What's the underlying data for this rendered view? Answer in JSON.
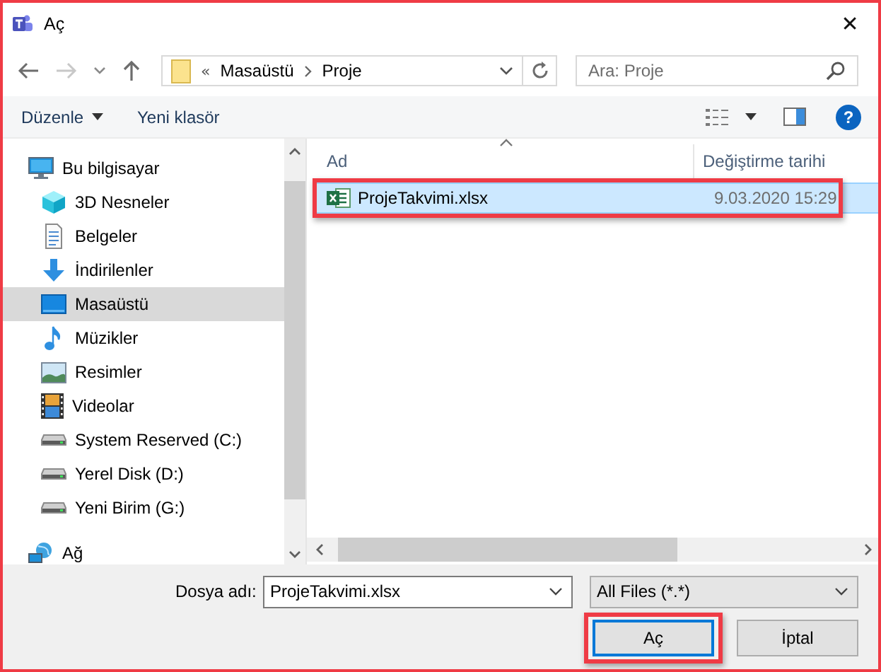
{
  "window": {
    "title": "Aç",
    "close": "✕"
  },
  "nav": {
    "back": {
      "disabled": false
    },
    "forward": {
      "disabled": true
    }
  },
  "address": {
    "overflow_mark": "«",
    "path": [
      {
        "label": "Masaüstü"
      },
      {
        "label": "Proje"
      }
    ]
  },
  "search": {
    "placeholder": "Ara: Proje"
  },
  "toolbar": {
    "organize": "Düzenle",
    "new_folder": "Yeni klasör",
    "help": "?"
  },
  "sidebar": {
    "items": [
      {
        "label": "Bu bilgisayar",
        "kind": "computer",
        "selected": false,
        "children": [
          {
            "label": "3D Nesneler",
            "kind": "cube",
            "selected": false
          },
          {
            "label": "Belgeler",
            "kind": "documents",
            "selected": false
          },
          {
            "label": "İndirilenler",
            "kind": "downloads",
            "selected": false
          },
          {
            "label": "Masaüstü",
            "kind": "desktop",
            "selected": true
          },
          {
            "label": "Müzikler",
            "kind": "music",
            "selected": false
          },
          {
            "label": "Resimler",
            "kind": "pictures",
            "selected": false
          },
          {
            "label": "Videolar",
            "kind": "videos",
            "selected": false
          },
          {
            "label": "System Reserved (C:)",
            "kind": "drive",
            "selected": false
          },
          {
            "label": "Yerel Disk (D:)",
            "kind": "drive",
            "selected": false
          },
          {
            "label": "Yeni Birim (G:)",
            "kind": "drive",
            "selected": false
          }
        ]
      },
      {
        "label": "Ağ",
        "kind": "network",
        "selected": false
      }
    ]
  },
  "file_list": {
    "columns": [
      "Ad",
      "Değiştirme tarihi"
    ],
    "rows": [
      {
        "name": "ProjeTakvimi.xlsx",
        "modified": "9.03.2020 15:29",
        "selected": true,
        "highlighted": true
      }
    ]
  },
  "bottom": {
    "filename_label": "Dosya adı:",
    "filename": "ProjeTakvimi.xlsx",
    "filter": "All Files (*.*)",
    "buttons": [
      {
        "label": "Aç",
        "default": true,
        "highlighted": true
      },
      {
        "label": "İptal",
        "default": false,
        "highlighted": false
      }
    ]
  }
}
